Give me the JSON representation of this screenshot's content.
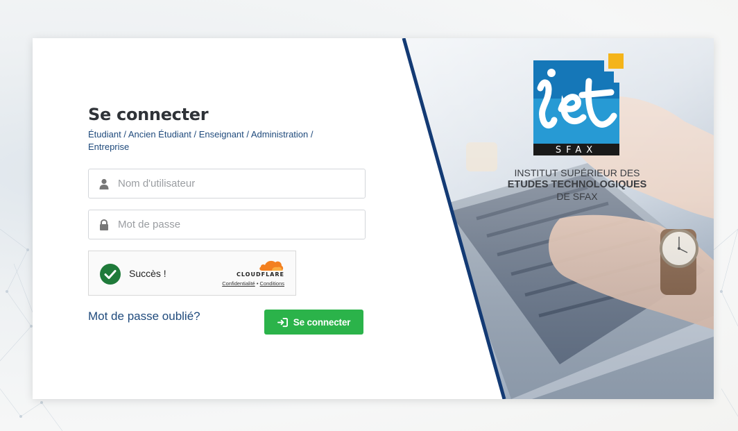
{
  "login": {
    "title": "Se connecter",
    "subtitle": "Étudiant / Ancien Étudiant / Enseignant / Administration / Entreprise",
    "username_placeholder": "Nom d'utilisateur",
    "password_placeholder": "Mot de passe",
    "forgot_label": "Mot de passe oublié?",
    "submit_label": "Se connecter"
  },
  "captcha": {
    "status": "Succès !",
    "brand": "CLOUDFLARE",
    "privacy_link": "Confidentialité",
    "separator": "•",
    "terms_link": "Conditions"
  },
  "institute": {
    "logo_word": "iset",
    "logo_city": "SFAX",
    "line1": "INSTITUT SUPÉRIEUR DES",
    "line2": "ETUDES TECHNOLOGIQUES",
    "line3": "DE SFAX"
  },
  "colors": {
    "accent_green": "#2bb34a",
    "link_blue": "#1f4a7c",
    "divider_navy": "#133a74",
    "logo_blue": "#1577b8",
    "logo_yellow": "#f4b41a",
    "cloudflare_orange": "#f38020"
  },
  "icons": {
    "username": "user-icon",
    "password": "lock-icon",
    "captcha_status": "check-circle-icon",
    "submit": "sign-in-icon"
  }
}
